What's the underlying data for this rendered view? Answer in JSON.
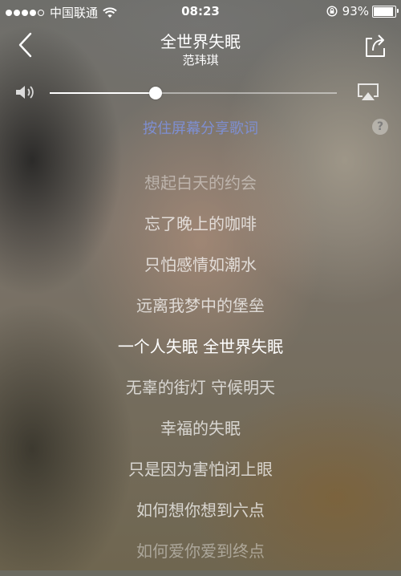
{
  "status_bar": {
    "carrier": "中国联通",
    "time": "08:23",
    "battery_percent": "93%",
    "battery_level": 0.93,
    "signal_bars_filled": 4,
    "signal_bars_total": 5
  },
  "header": {
    "title": "全世界失眠",
    "artist": "范玮琪"
  },
  "volume": {
    "level": 0.37
  },
  "hint": {
    "text": "按住屏幕分享歌词",
    "help": "?"
  },
  "lyrics": [
    {
      "text": "想起白天的约会",
      "state": "faded"
    },
    {
      "text": "忘了晚上的咖啡",
      "state": "normal"
    },
    {
      "text": "只怕感情如潮水",
      "state": "normal"
    },
    {
      "text": "远离我梦中的堡垒",
      "state": "normal"
    },
    {
      "text": "一个人失眠 全世界失眠",
      "state": "current"
    },
    {
      "text": "无辜的街灯 守候明天",
      "state": "normal"
    },
    {
      "text": "幸福的失眠",
      "state": "normal"
    },
    {
      "text": "只是因为害怕闭上眼",
      "state": "normal"
    },
    {
      "text": "如何想你想到六点",
      "state": "normal"
    },
    {
      "text": "如何爱你爱到终点",
      "state": "faded"
    }
  ],
  "colors": {
    "hint": "#7e8fd2",
    "current_lyric": "#ffffff"
  },
  "icons": {
    "back": "chevron-left-icon",
    "share": "share-icon",
    "volume": "speaker-icon",
    "airplay": "airplay-icon",
    "wifi": "wifi-icon",
    "rotation_lock": "rotation-lock-icon",
    "battery": "battery-icon"
  }
}
